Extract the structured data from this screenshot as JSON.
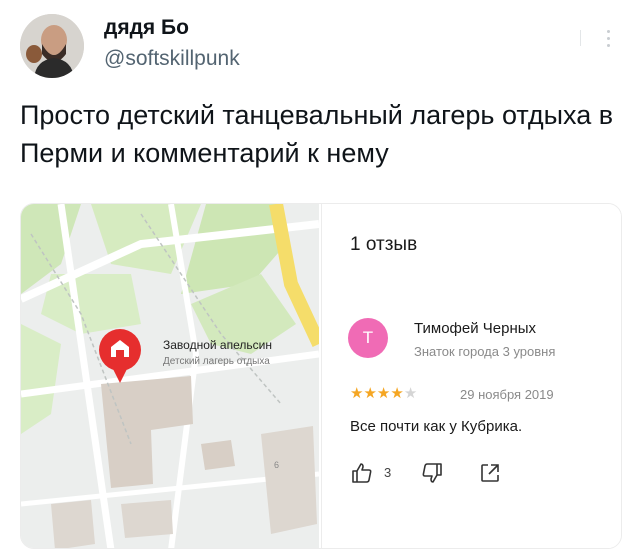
{
  "tweet": {
    "display_name": "дядя Бо",
    "handle": "@softskillpunk",
    "text": "Просто детский танцевальный лагерь отдыха в Перми и комментарий к нему"
  },
  "map": {
    "place_name": "Заводной апельсин",
    "place_type": "Детский лагерь отдыха",
    "building_number": "6"
  },
  "reviews": {
    "count_label": "1 отзыв",
    "reviewer_initial": "Т",
    "reviewer_name": "Тимофей Черных",
    "reviewer_level": "Знаток города 3 уровня",
    "rating": 4,
    "rating_max": 5,
    "date": "29 ноября 2019",
    "text": "Все почти как у Кубрика.",
    "likes": "3"
  },
  "colors": {
    "accent_pink": "#f06bb5",
    "star": "#f5a623",
    "pin_red": "#e62e2e"
  },
  "icons": [
    "more-icon",
    "like-icon",
    "dislike-icon",
    "share-icon",
    "map-pin-icon"
  ]
}
